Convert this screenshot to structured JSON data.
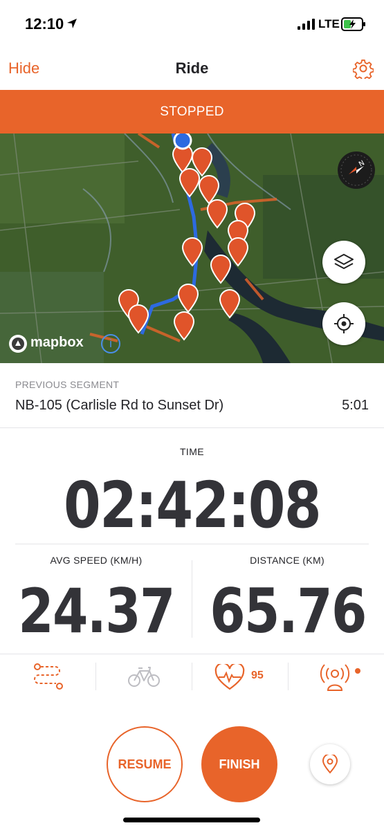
{
  "status_bar": {
    "time": "12:10",
    "network": "LTE",
    "icons": [
      "location-arrow-icon",
      "signal-icon",
      "battery-charging-icon"
    ]
  },
  "nav": {
    "left_action": "Hide",
    "title": "Ride",
    "right_icon": "gear-icon"
  },
  "banner": {
    "status": "STOPPED"
  },
  "map": {
    "attribution": "mapbox",
    "controls": [
      "compass-icon",
      "layers-icon",
      "recenter-icon",
      "info-icon"
    ]
  },
  "segment": {
    "caption": "PREVIOUS SEGMENT",
    "name": "NB-105 (Carlisle Rd to Sunset Dr)",
    "time": "5:01"
  },
  "stats": {
    "time_label": "TIME",
    "time_value": "02:42:08",
    "avg_speed_label": "AVG SPEED (KM/H)",
    "avg_speed_value": "24.37",
    "distance_label": "DISTANCE (KM)",
    "distance_value": "65.76"
  },
  "sensors": {
    "heart_rate": "95",
    "icons": [
      "route-icon",
      "bike-icon",
      "heart-rate-icon",
      "beacon-icon"
    ]
  },
  "actions": {
    "resume": "RESUME",
    "finish": "FINISH",
    "pin_icon": "location-pin-icon"
  },
  "colors": {
    "accent": "#e8642a",
    "text": "#242428",
    "divider": "#e4e4e8"
  }
}
